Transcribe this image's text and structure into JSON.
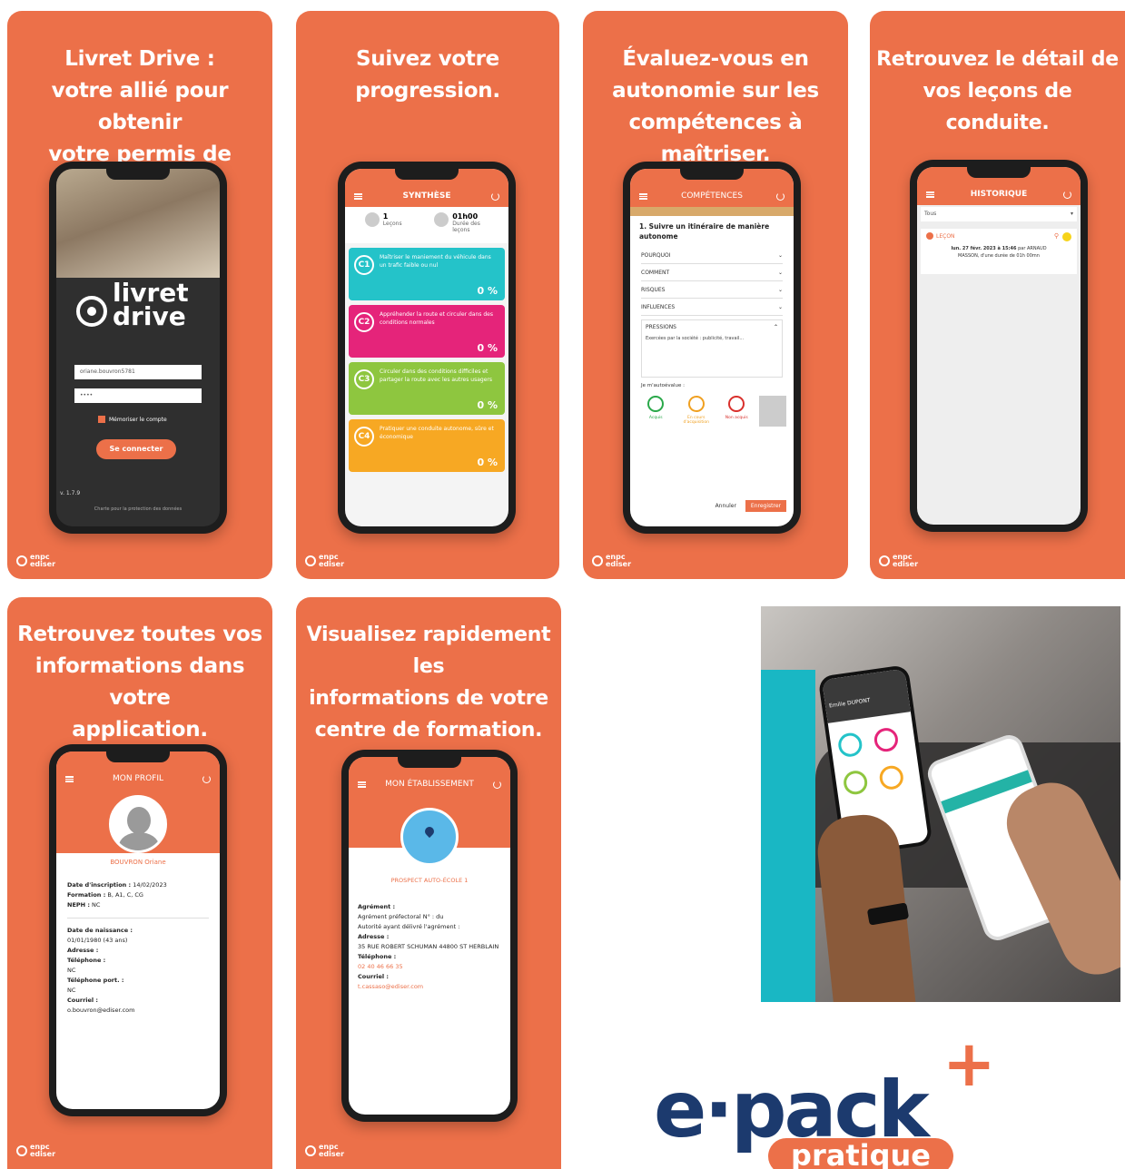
{
  "brand": {
    "name_line1": "enpc",
    "name_line2": "ediser"
  },
  "cards": {
    "login": {
      "title1": "Livret Drive :",
      "title2": "votre allié pour obtenir",
      "title3": "votre permis de conduire.",
      "logo_line1": "livret",
      "logo_line2": "drive",
      "username": "oriane.bouvron5781",
      "password": "••••",
      "remember": "Mémoriser le compte",
      "connect": "Se connecter",
      "version": "v. 1.7.9",
      "footer": "Charte pour la protection des données"
    },
    "synthese": {
      "title1": "Suivez votre",
      "title2": "progression.",
      "appbar": "SYNTHÈSE",
      "stat1_value": "1",
      "stat1_label": "Leçons",
      "stat2_value": "01h00",
      "stat2_label": "Durée des leçons",
      "tiles": [
        {
          "code": "C1",
          "text": "Maîtriser le maniement du véhicule dans un trafic faible ou nul",
          "pct": "0 %",
          "color": "#24c3c9"
        },
        {
          "code": "C2",
          "text": "Appréhender la route et circuler dans des conditions normales",
          "pct": "0 %",
          "color": "#e5247a"
        },
        {
          "code": "C3",
          "text": "Circuler dans des conditions difficiles et partager la route avec les autres usagers",
          "pct": "0 %",
          "color": "#8ec63f"
        },
        {
          "code": "C4",
          "text": "Pratiquer une conduite autonome, sûre et économique",
          "pct": "0 %",
          "color": "#f7a823"
        }
      ]
    },
    "competences": {
      "title1": "Évaluez-vous en",
      "title2": "autonomie sur les",
      "title3": "compétences à maîtriser.",
      "appbar": "COMPÉTENCES",
      "heading": "1. Suivre un itinéraire de manière autonome",
      "rows": [
        "POURQUOI",
        "COMMENT",
        "RISQUES",
        "INFLUENCES"
      ],
      "open_row": "PRESSIONS",
      "open_text": "Exercées par la société : publicité, travail...",
      "self_eval": "Je m'autoévalue :",
      "ratings": [
        "Acquis",
        "En cours d'acquisition",
        "Non acquis"
      ],
      "cancel": "Annuler",
      "save": "Enregistrer"
    },
    "historique": {
      "title1": "Retrouvez le détail de",
      "title2": "vos leçons de conduite.",
      "appbar": "HISTORIQUE",
      "filter": "Tous",
      "entry_type": "LEÇON",
      "entry_date": "lun. 27 févr. 2023 à 15:46",
      "entry_by": "par ARNAUD",
      "entry_who": "MASSON, d'une durée de 01h 00mn"
    },
    "profil": {
      "title1": "Retrouvez toutes vos",
      "title2": "informations dans votre",
      "title3": "application.",
      "appbar": "MON PROFIL",
      "name": "BOUVRON Oriane",
      "inscription_label": "Date d'inscription :",
      "inscription_value": "14/02/2023",
      "formation_label": "Formation :",
      "formation_value": "B, A1, C, CG",
      "neph_label": "NEPH :",
      "neph_value": "NC",
      "birth_label": "Date de naissance :",
      "birth_value": "01/01/1980 (43 ans)",
      "address_label": "Adresse :",
      "phone_label": "Téléphone :",
      "phone_value": "NC",
      "mobile_label": "Téléphone port. :",
      "mobile_value": "NC",
      "email_label": "Courriel :",
      "email_value": "o.bouvron@ediser.com"
    },
    "etablissement": {
      "title1": "Visualisez rapidement les",
      "title2": "informations de votre",
      "title3": "centre de formation.",
      "appbar": "MON ÉTABLISSEMENT",
      "name": "PROSPECT AUTO-ÉCOLE 1",
      "agrement_label": "Agrément :",
      "agrement_value": "Agrément préfectoral N° : du",
      "autorite": "Autorité ayant délivré l'agrément :",
      "address_label": "Adresse :",
      "address_value": "35 RUE ROBERT SCHUMAN 44800 ST HERBLAIN",
      "phone_label": "Téléphone :",
      "phone_value": "02 40 46 66 35",
      "email_label": "Courriel :",
      "email_value": "t.cassaso@ediser.com"
    }
  },
  "photo": {
    "phone_name": "Emilie DUPONT"
  },
  "epack": {
    "word": "e·pack",
    "plus": "+",
    "sub": "pratique"
  }
}
